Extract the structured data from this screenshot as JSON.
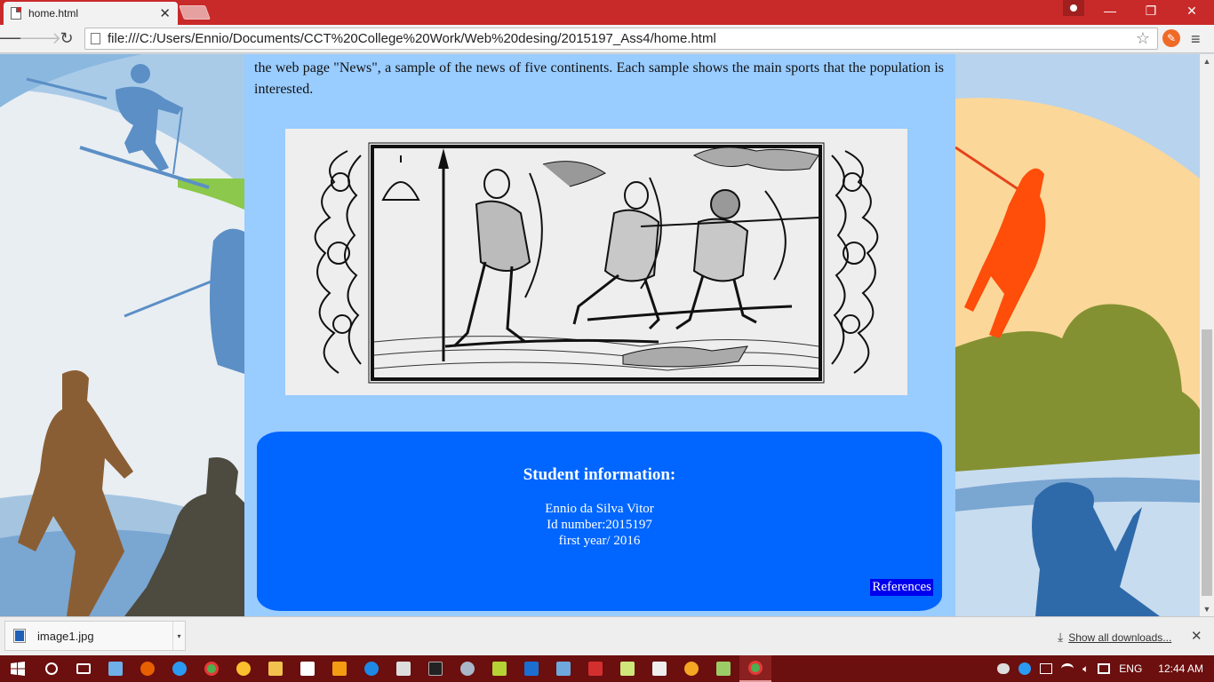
{
  "browser": {
    "tab_title": "home.html",
    "tab_close": "✕",
    "url": "file:///C:/Users/Ennio/Documents/CCT%20College%20Work/Web%20desing/2015197_Ass4/home.html",
    "window_controls": {
      "minimize": "—",
      "restore": "❐",
      "close": "✕"
    }
  },
  "page": {
    "intro_text": "the web page \"News\", a sample of the news of five continents. Each sample shows the main sports that the population is interested.",
    "student_box": {
      "heading": "Student information:",
      "name": "Ennio da Silva Vitor",
      "id_line": "Id number:2015197",
      "year_line": "first year/ 2016",
      "references": "References"
    }
  },
  "downloads": {
    "file_name": "image1.jpg",
    "show_all": "Show all downloads...",
    "close": "✕"
  },
  "taskbar": {
    "language": "ENG",
    "time": "12:44 AM"
  },
  "colors": {
    "titlebar": "#c82a2a",
    "content_bg": "#99ccff",
    "info_box": "#0066ff",
    "references_bg": "#0000ee",
    "taskbar": "#6b0f0f"
  }
}
